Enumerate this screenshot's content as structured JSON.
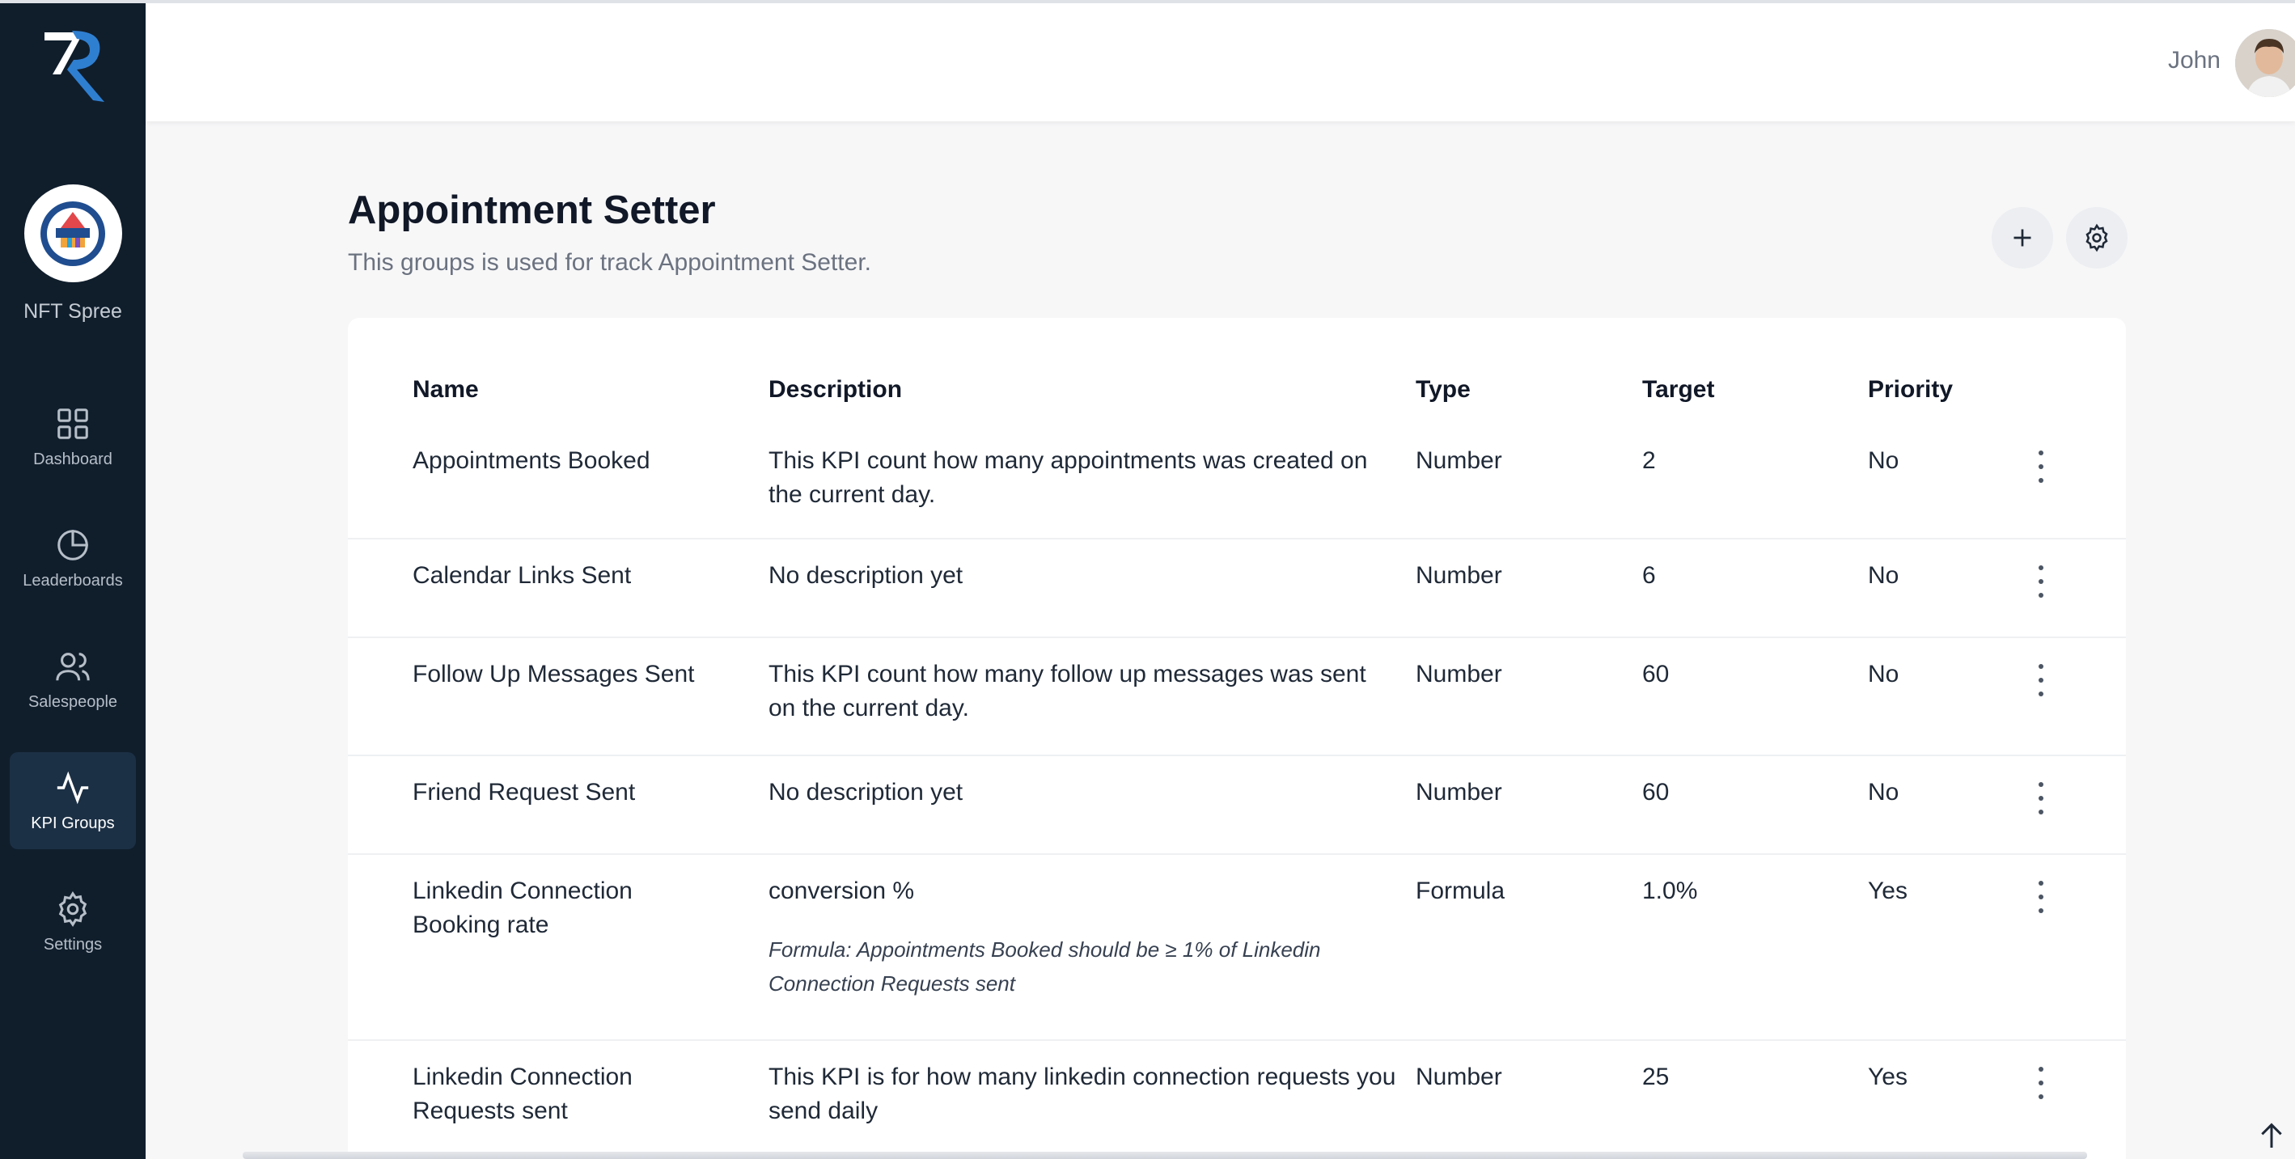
{
  "sidebar": {
    "org_name": "NFT Spree",
    "nav": [
      {
        "label": "Dashboard",
        "icon": "grid-icon"
      },
      {
        "label": "Leaderboards",
        "icon": "pie-chart-icon"
      },
      {
        "label": "Salespeople",
        "icon": "users-icon"
      },
      {
        "label": "KPI Groups",
        "icon": "activity-icon",
        "active": true
      },
      {
        "label": "Settings",
        "icon": "gear-icon"
      }
    ]
  },
  "header": {
    "user_name": "John"
  },
  "group": {
    "title": "Appointment Setter",
    "subtitle": "This groups is used for track Appointment Setter."
  },
  "table": {
    "headers": {
      "name": "Name",
      "description": "Description",
      "type": "Type",
      "target": "Target",
      "priority": "Priority"
    },
    "rows": [
      {
        "name": "Appointments Booked",
        "description": "This KPI count how many appointments was created on the current day.",
        "type": "Number",
        "target": "2",
        "priority": "No"
      },
      {
        "name": "Calendar Links Sent",
        "description": "No description yet",
        "type": "Number",
        "target": "6",
        "priority": "No"
      },
      {
        "name": "Follow Up Messages Sent",
        "description": "This KPI count how many follow up messages was sent on the current day.",
        "type": "Number",
        "target": "60",
        "priority": "No"
      },
      {
        "name": "Friend Request Sent",
        "description": "No description yet",
        "type": "Number",
        "target": "60",
        "priority": "No"
      },
      {
        "name": "Linkedin Connection Booking rate",
        "description": "conversion %",
        "formula": "Formula: Appointments Booked should be ≥ 1% of Linkedin Connection Requests sent",
        "type": "Formula",
        "target": "1.0%",
        "priority": "Yes"
      },
      {
        "name": "Linkedin Connection Requests sent",
        "description": "This KPI is for how many linkedin connection requests you send daily",
        "type": "Number",
        "target": "25",
        "priority": "Yes"
      }
    ]
  },
  "colors": {
    "sidebar_bg": "#101e2c",
    "active_bg": "#1c3045",
    "logo_blue": "#2f7fd1"
  }
}
